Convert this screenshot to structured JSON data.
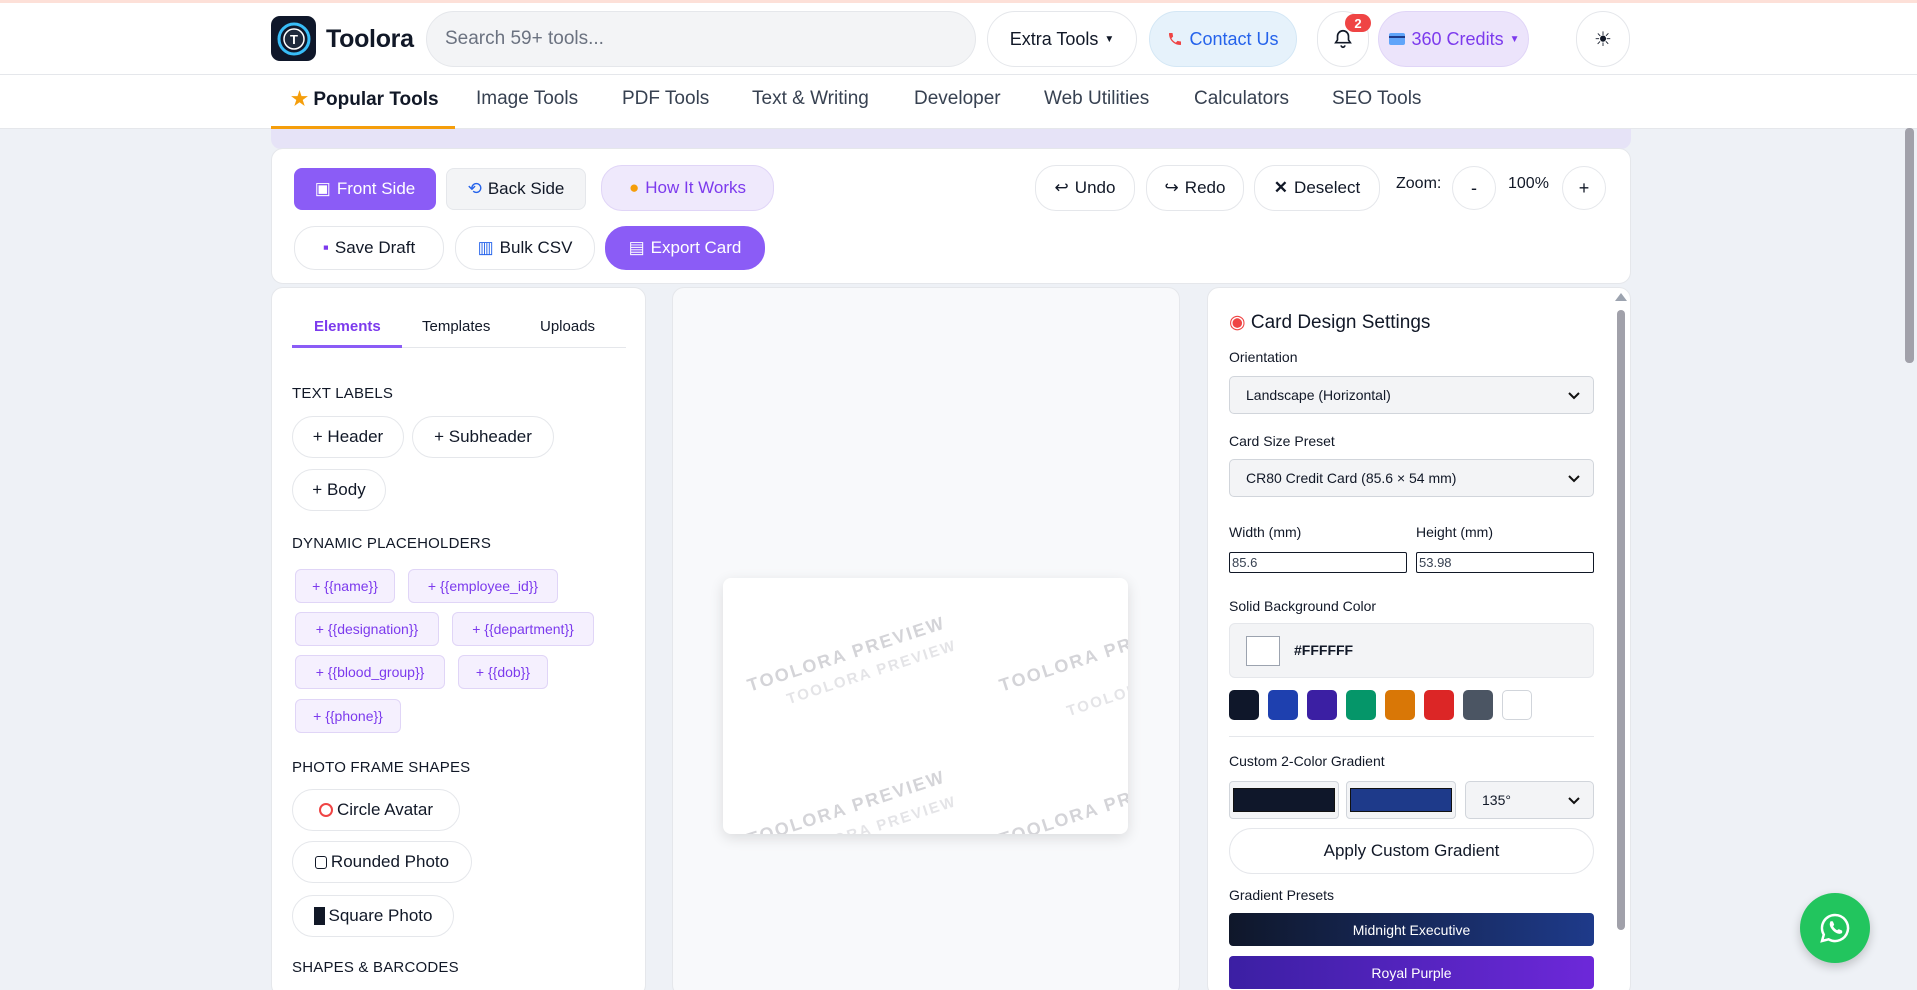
{
  "header": {
    "brand": "Toolora",
    "search_placeholder": "Search 59+ tools...",
    "extra_tools": "Extra Tools",
    "contact": "Contact Us",
    "notifications_count": "2",
    "credits": "360 Credits",
    "theme_icon": "☀"
  },
  "nav": {
    "items": [
      "Popular Tools",
      "Image Tools",
      "PDF Tools",
      "Text & Writing",
      "Developer",
      "Web Utilities",
      "Calculators",
      "SEO Tools"
    ],
    "active_index": 0
  },
  "toolbar": {
    "front_side": "Front Side",
    "back_side": "Back Side",
    "how_it_works": "How It Works",
    "undo": "Undo",
    "redo": "Redo",
    "deselect": "Deselect",
    "zoom_label": "Zoom:",
    "zoom_minus": "-",
    "zoom_value": "100%",
    "zoom_plus": "+",
    "save_draft": "Save Draft",
    "bulk_csv": "Bulk CSV",
    "export_card": "Export Card"
  },
  "left_panel": {
    "tabs": [
      "Elements",
      "Templates",
      "Uploads"
    ],
    "text_labels_title": "TEXT LABELS",
    "text_labels": [
      "+ Header",
      "+ Subheader",
      "+ Body"
    ],
    "placeholders_title": "DYNAMIC PLACEHOLDERS",
    "placeholders": [
      "+ {{name}}",
      "+ {{employee_id}}",
      "+ {{designation}}",
      "+ {{department}}",
      "+ {{blood_group}}",
      "+ {{dob}}",
      "+ {{phone}}"
    ],
    "photo_title": "PHOTO FRAME SHAPES",
    "photo_shapes": [
      "Circle Avatar",
      "Rounded Photo",
      "Square Photo"
    ],
    "shapes_title": "SHAPES & BARCODES"
  },
  "canvas": {
    "watermark": "TOOLORA PREVIEW"
  },
  "right_panel": {
    "title": "Card Design Settings",
    "orientation_label": "Orientation",
    "orientation_value": "Landscape (Horizontal)",
    "size_label": "Card Size Preset",
    "size_value": "CR80 Credit Card (85.6 × 54 mm)",
    "width_label": "Width (mm)",
    "width_value": "85.6",
    "height_label": "Height (mm)",
    "height_value": "53.98",
    "bg_label": "Solid Background Color",
    "bg_value": "#FFFFFF",
    "swatches": [
      "#0f172a",
      "#1e40af",
      "#3b1fa3",
      "#059669",
      "#d97706",
      "#dc2626",
      "#4b5563",
      "#ffffff"
    ],
    "gradient_label": "Custom 2-Color Gradient",
    "gradient_color_1": "#0f172a",
    "gradient_color_2": "#1e3a8a",
    "gradient_angle": "135°",
    "apply_gradient": "Apply Custom Gradient",
    "presets_label": "Gradient Presets",
    "presets": [
      {
        "name": "Midnight Executive",
        "from": "#0f172a",
        "to": "#1e3a8a"
      },
      {
        "name": "Royal Purple",
        "from": "#3b1fa3",
        "to": "#6d28d9"
      }
    ]
  },
  "icons": {
    "logo": "toolora-logo-icon",
    "bell": "bell-icon",
    "whatsapp": "whatsapp-icon"
  },
  "colors": {
    "accent": "#8b5cf6",
    "nav_underline": "#f59e0b",
    "whatsapp": "#22c55e"
  }
}
